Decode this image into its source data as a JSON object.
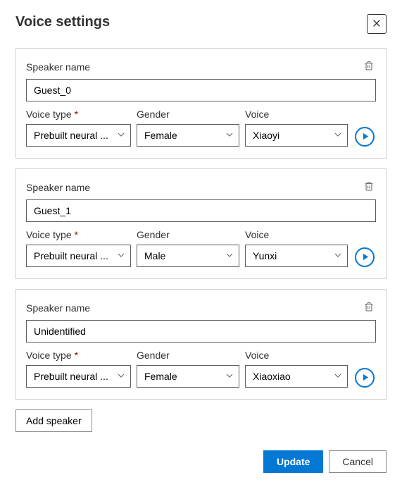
{
  "title": "Voice settings",
  "labels": {
    "speakerName": "Speaker name",
    "voiceType": "Voice type",
    "gender": "Gender",
    "voice": "Voice"
  },
  "speakers": [
    {
      "name": "Guest_0",
      "voiceType": "Prebuilt neural ...",
      "gender": "Female",
      "voice": "Xiaoyi"
    },
    {
      "name": "Guest_1",
      "voiceType": "Prebuilt neural ...",
      "gender": "Male",
      "voice": "Yunxi"
    },
    {
      "name": "Unidentified",
      "voiceType": "Prebuilt neural ...",
      "gender": "Female",
      "voice": "Xiaoxiao"
    }
  ],
  "buttons": {
    "addSpeaker": "Add speaker",
    "update": "Update",
    "cancel": "Cancel"
  }
}
